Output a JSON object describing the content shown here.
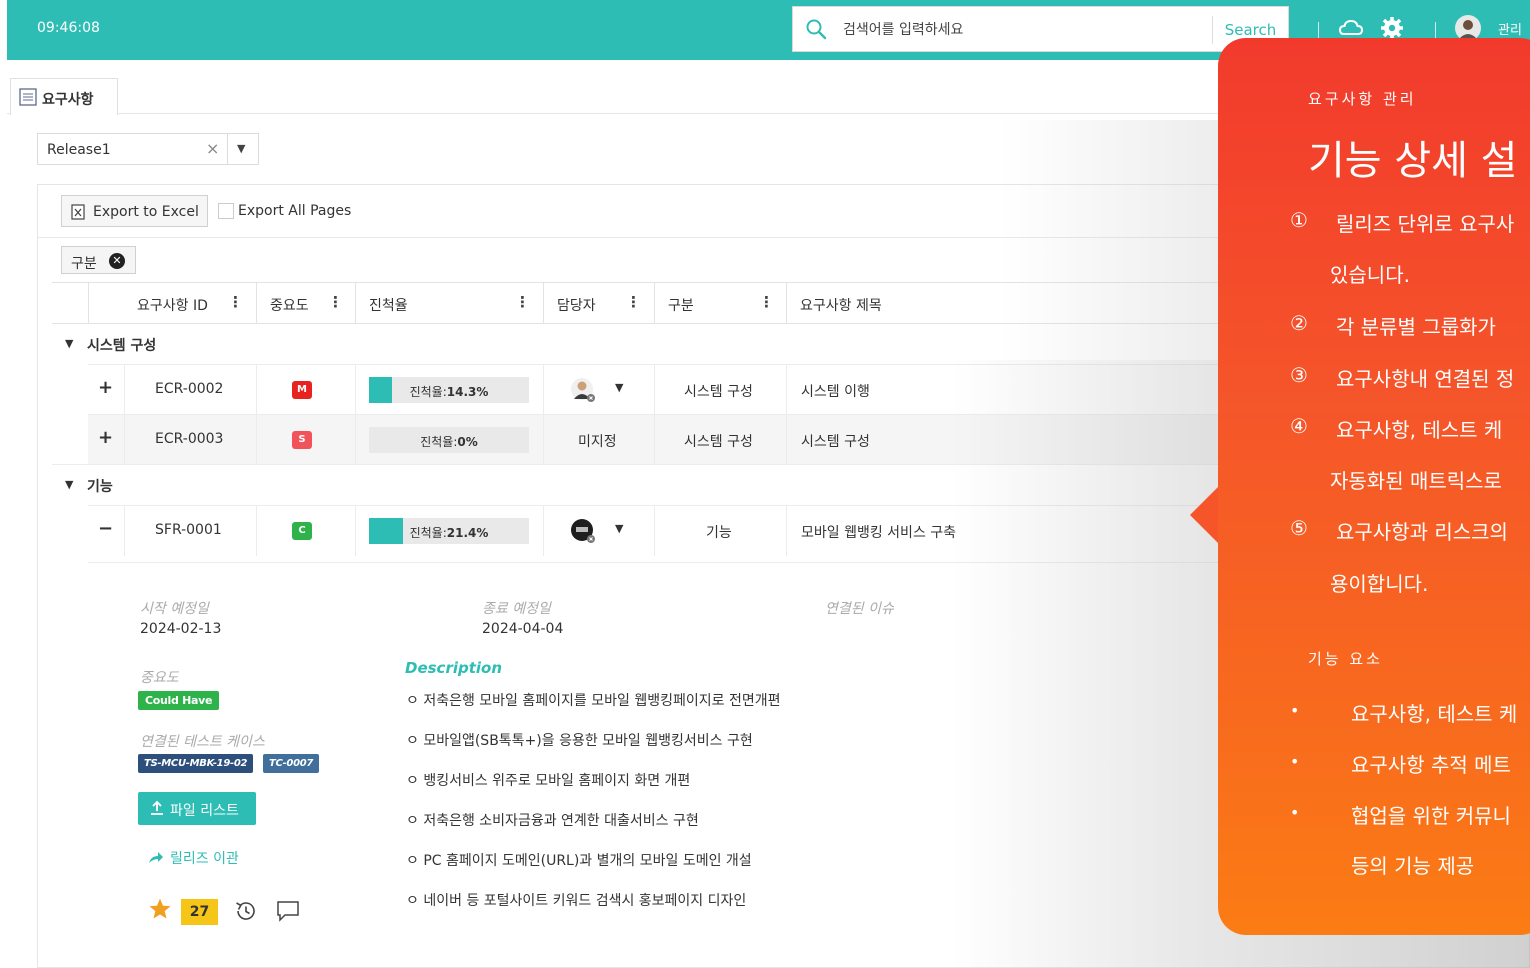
{
  "topbar": {
    "clock": "09:46:08",
    "search_placeholder": "검색어를 입력하세요",
    "search_button": "Search",
    "admin_label": "관리자"
  },
  "tab": {
    "label": "요구사항"
  },
  "release_select": {
    "value": "Release1",
    "clear": "×",
    "arrow": "▼"
  },
  "toolbar": {
    "export_excel": "Export to Excel",
    "export_all_pages": "Export All Pages"
  },
  "group_chip": {
    "label": "구분",
    "remove": "✕"
  },
  "columns": {
    "id": "요구사항 ID",
    "priority": "중요도",
    "progress": "진척율",
    "owner": "담당자",
    "category": "구분",
    "title": "요구사항 제목",
    "menu": "⋮"
  },
  "groups": [
    {
      "caret": "▼",
      "label": "시스템 구성"
    },
    {
      "caret": "▼",
      "label": "기능"
    }
  ],
  "rows": [
    {
      "expander": "+",
      "id": "ECR-0002",
      "priority": "M",
      "priority_color": "#e8231f",
      "progress_label": "진척율:",
      "progress_value": "14.3%",
      "progress": 0.143,
      "owner": "",
      "category": "시스템 구성",
      "title": "시스템 이행"
    },
    {
      "expander": "+",
      "id": "ECR-0003",
      "priority": "S",
      "priority_color": "#f0545a",
      "progress_label": "진척율:",
      "progress_value": "0%",
      "progress": 0.0,
      "owner": "미지정",
      "category": "시스템 구성",
      "title": "시스템 구성"
    },
    {
      "expander": "−",
      "id": "SFR-0001",
      "priority": "C",
      "priority_color": "#2db34a",
      "progress_label": "진척율:",
      "progress_value": "21.4%",
      "progress": 0.214,
      "owner": "",
      "category": "기능",
      "title": "모바일 웹뱅킹 서비스 구축"
    }
  ],
  "owner_caret": "▼",
  "detail": {
    "start_label": "시작 예정일",
    "start_value": "2024-02-13",
    "end_label": "종료 예정일",
    "end_value": "2024-04-04",
    "issue_label": "연결된 이슈",
    "priority_label": "중요도",
    "priority_badge": "Could Have",
    "testcase_label": "연결된 테스트 케이스",
    "testcases": [
      "TS-MCU-MBK-19-02",
      "TC-0007"
    ],
    "file_button": "파일 리스트",
    "release_move": "릴리즈 이관",
    "count": "27",
    "description_title": "Description",
    "description": [
      "ㅇ 저축은행 모바일 홈페이지를 모바일 웹뱅킹페이지로 전면개편",
      "ㅇ 모바일앱(SB톡톡+)을 응용한 모바일 웹뱅킹서비스 구현",
      "ㅇ 뱅킹서비스 위주로 모바일 홈페이지 화면 개편",
      "ㅇ 저축은행 소비자금융과 연계한 대출서비스 구현",
      "ㅇ PC 홈페이지 도메인(URL)과 별개의 모바일 도메인 개설",
      "ㅇ 네이버 등 포털사이트 키워드 검색시 홍보페이지 디자인"
    ]
  },
  "callout": {
    "subtitle": "요구사항 관리",
    "title": "기능 상세 설",
    "items": [
      {
        "num": "①",
        "text": "릴리즈 단위로 요구사",
        "cont": "있습니다."
      },
      {
        "num": "②",
        "text": "각 분류별 그룹화가",
        "cont": ""
      },
      {
        "num": "③",
        "text": "요구사항내 연결된 정",
        "cont": ""
      },
      {
        "num": "④",
        "text": "요구사항, 테스트 케",
        "cont": "자동화된 매트릭스로"
      },
      {
        "num": "⑤",
        "text": "요구사항과 리스크의",
        "cont": "용이합니다."
      }
    ],
    "section": "기능 요소",
    "bullets": [
      {
        "dot": "•",
        "text": "요구사항, 테스트 케",
        "cont": ""
      },
      {
        "dot": "•",
        "text": "요구사항 추적 메트",
        "cont": ""
      },
      {
        "dot": "•",
        "text": "협업을 위한 커뮤니",
        "cont": "등의 기능 제공"
      }
    ]
  }
}
